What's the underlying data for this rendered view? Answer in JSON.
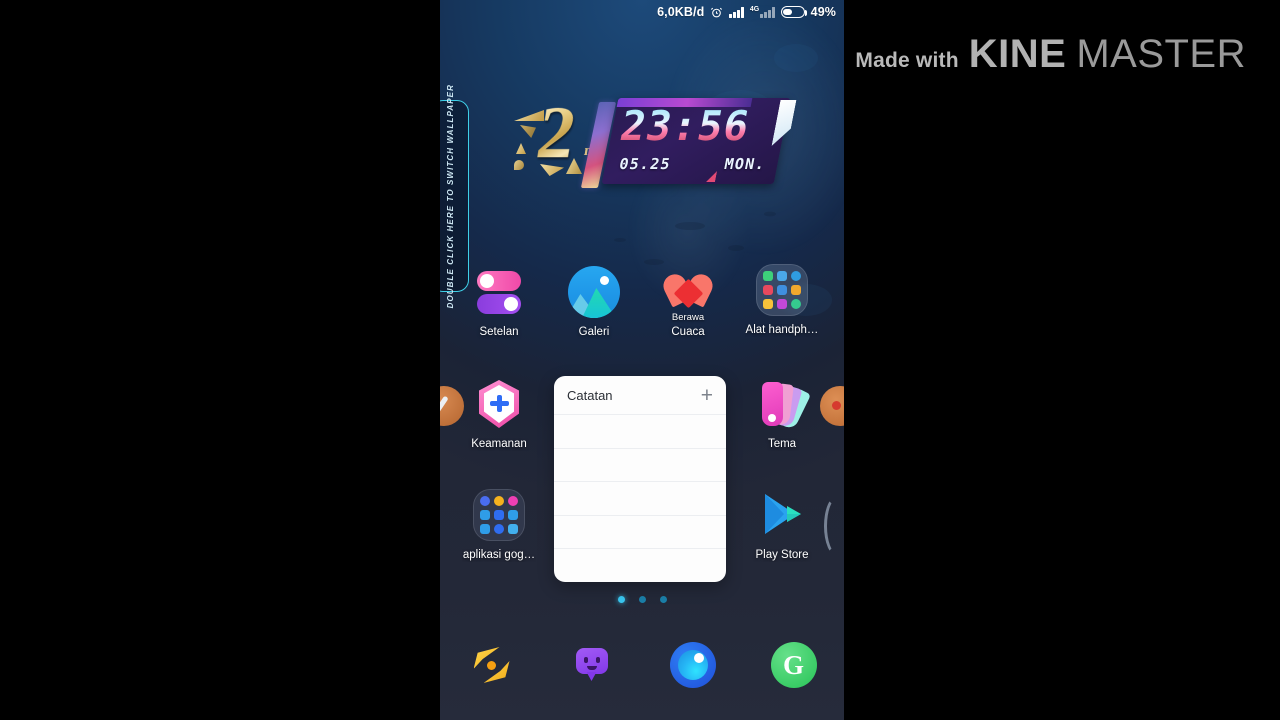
{
  "watermark": {
    "made_with": "Made with",
    "kine": "KINE",
    "master": "MASTER"
  },
  "status_bar": {
    "data_rate": "6,0KB/d",
    "alarm_icon": "alarm-clock-icon",
    "signal_1_icon": "signal-bars-icon",
    "network_label": "4G",
    "signal_2_icon": "signal-bars-icon",
    "battery_icon": "battery-icon",
    "battery_percent": "49%"
  },
  "wallpaper_hint": {
    "text": "DOUBLE CLICK HERE TO SWITCH WALLPAPER",
    "accent": "#3fd0e8"
  },
  "clock_widget": {
    "emblem_number": "2",
    "emblem_suffix": "nd",
    "time": "23:56",
    "date": "05.25",
    "day": "MON."
  },
  "home_screen": {
    "rows": [
      [
        {
          "label": "Setelan",
          "icon": "settings-toggles-icon"
        },
        {
          "label": "Galeri",
          "icon": "gallery-icon"
        },
        {
          "label": "Cuaca",
          "icon": "weather-heart-icon",
          "sublabel": "Berawa"
        },
        {
          "label": "Alat handph…",
          "icon": "tools-folder-icon"
        }
      ],
      [
        {
          "label": "Keamanan",
          "icon": "security-shield-icon"
        },
        {
          "label": "Tema",
          "icon": "theme-palette-icon"
        }
      ],
      [
        {
          "label": "aplikasi gog…",
          "icon": "google-apps-folder-icon"
        },
        {
          "label": "Play Store",
          "icon": "play-store-icon"
        }
      ]
    ]
  },
  "notes_widget": {
    "title": "Catatan",
    "add_icon": "plus-icon",
    "line_count": 5
  },
  "page_indicator": {
    "count": 3,
    "active_index": 0
  },
  "dock": [
    {
      "name": "bolt-app-icon"
    },
    {
      "name": "chat-bubble-app-icon"
    },
    {
      "name": "browser-app-icon"
    },
    {
      "name": "green-g-app-icon"
    }
  ]
}
